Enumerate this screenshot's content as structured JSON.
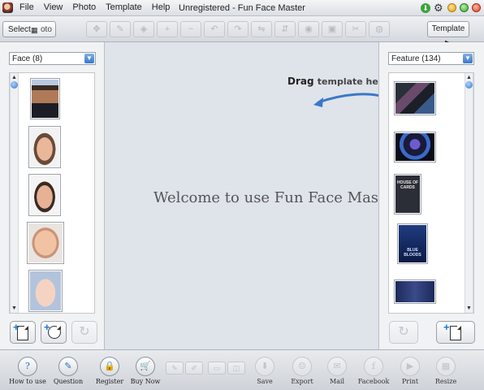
{
  "window": {
    "title": "Unregistered - Fun Face Master"
  },
  "menu": [
    "File",
    "View",
    "Photo",
    "Template",
    "Help"
  ],
  "toolbar": {
    "select_label": "Select",
    "select_suffix": "oto",
    "template_label": "Template ▶"
  },
  "left_panel": {
    "dropdown_value": "Face (8)",
    "thumbnails": [
      "man in suit",
      "boy face",
      "young man face",
      "baby face",
      "baby face 2"
    ]
  },
  "right_panel": {
    "dropdown_value": "Feature (134)",
    "thumbnails": [
      "two men poster",
      "blue team poster",
      "House of Cards poster",
      "Blue Bloods poster",
      "Blue Bloods group poster"
    ],
    "poster_text_1": "HOUSE OF CARDS",
    "poster_text_2": "BLUE BLOODS"
  },
  "canvas": {
    "welcome_text": "Welcome to use Fun Face Master",
    "hint_bold": "Drag",
    "hint_rest": "template here"
  },
  "bottom_bar": {
    "items": [
      {
        "label": "How to use",
        "icon": "question-icon",
        "glyph": "?"
      },
      {
        "label": "Question",
        "icon": "edit-icon",
        "glyph": "✎"
      },
      {
        "label": "Register",
        "icon": "lock-icon",
        "glyph": "🔒"
      },
      {
        "label": "Buy Now",
        "icon": "cart-icon",
        "glyph": "🛒"
      },
      {
        "label": "Save",
        "icon": "save-icon",
        "glyph": "⬇"
      },
      {
        "label": "Export",
        "icon": "export-icon",
        "glyph": "☺"
      },
      {
        "label": "Mail",
        "icon": "mail-icon",
        "glyph": "✉"
      },
      {
        "label": "Facebook",
        "icon": "facebook-icon",
        "glyph": "f"
      },
      {
        "label": "Print",
        "icon": "print-icon",
        "glyph": "▶"
      },
      {
        "label": "Resize",
        "icon": "resize-icon",
        "glyph": "▦"
      }
    ]
  },
  "colors": {
    "accent": "#1a7ad4",
    "canvas_bg": "#dfe3ea"
  }
}
